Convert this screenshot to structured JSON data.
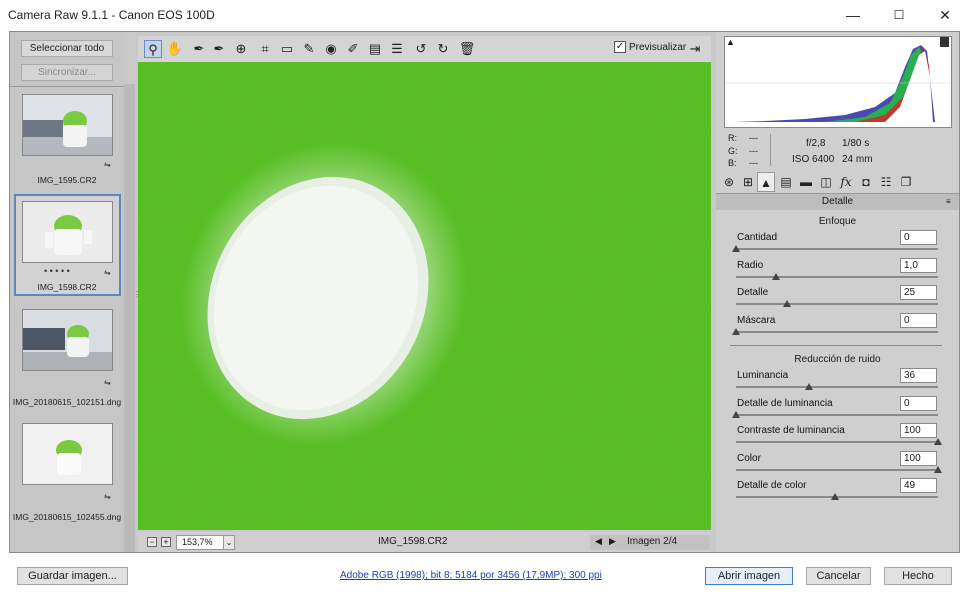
{
  "window": {
    "title": "Camera Raw 9.1.1 -  Canon EOS 100D",
    "minimize": "—",
    "maximize": "☐",
    "close": "✕"
  },
  "filmstrip": {
    "select_all": "Seleccionar todo",
    "sync": "Sincronizar...",
    "items": [
      {
        "name": "IMG_1595.CR2"
      },
      {
        "name": "IMG_1598.CR2",
        "selected": true,
        "rating": "• • • • •"
      },
      {
        "name": "IMG_20180615_102151.dng"
      },
      {
        "name": "IMG_20180615_102455.dng"
      }
    ]
  },
  "toolbar": {
    "tools": [
      "zoom-icon",
      "hand-icon",
      "white-balance-icon",
      "color-sampler-icon",
      "targeted-adjustment-icon",
      "crop-icon",
      "straighten-icon",
      "spot-removal-icon",
      "red-eye-icon",
      "adjustment-brush-icon",
      "graduated-filter-icon",
      "radial-filter-icon",
      "rotate-ccw-icon",
      "rotate-cw-icon",
      "trash-icon"
    ],
    "preview_label": "Previsualizar",
    "preview_checked": true
  },
  "bottom": {
    "zoom": "153,7%",
    "filename": "IMG_1598.CR2",
    "image_index": "Imagen 2/4"
  },
  "histogram": {
    "r": "---",
    "g": "---",
    "b": "---",
    "r_label": "R:",
    "g_label": "G:",
    "b_label": "B:",
    "aperture": "f/2,8",
    "shutter": "1/80 s",
    "iso": "ISO 6400",
    "focal": "24 mm"
  },
  "panel": {
    "title": "Detalle",
    "sharpening": {
      "heading": "Enfoque",
      "sliders": [
        {
          "label": "Cantidad",
          "value": "0",
          "level": 0.0
        },
        {
          "label": "Radio",
          "value": "1,0",
          "level": 0.2
        },
        {
          "label": "Detalle",
          "value": "25",
          "level": 0.25
        },
        {
          "label": "Máscara",
          "value": "0",
          "level": 0.0
        }
      ]
    },
    "noise": {
      "heading": "Reducción de ruido",
      "sliders": [
        {
          "label": "Luminancia",
          "value": "36",
          "level": 0.36
        },
        {
          "label": "Detalle de luminancia",
          "value": "0",
          "level": 0.0
        },
        {
          "label": "Contraste de luminancia",
          "value": "100",
          "level": 1.0
        },
        {
          "label": "Color",
          "value": "100",
          "level": 1.0
        },
        {
          "label": "Detalle de color",
          "value": "49",
          "level": 0.49
        }
      ]
    }
  },
  "footer": {
    "save": "Guardar imagen...",
    "workflow_link": "Adobe RGB (1998); bit 8; 5184 por 3456 (17,9MP); 300 ppi",
    "open": "Abrir imagen",
    "cancel": "Cancelar",
    "done": "Hecho"
  },
  "colors": {
    "accent": "#5f87b7",
    "preview_green": "#4fbf1a"
  }
}
